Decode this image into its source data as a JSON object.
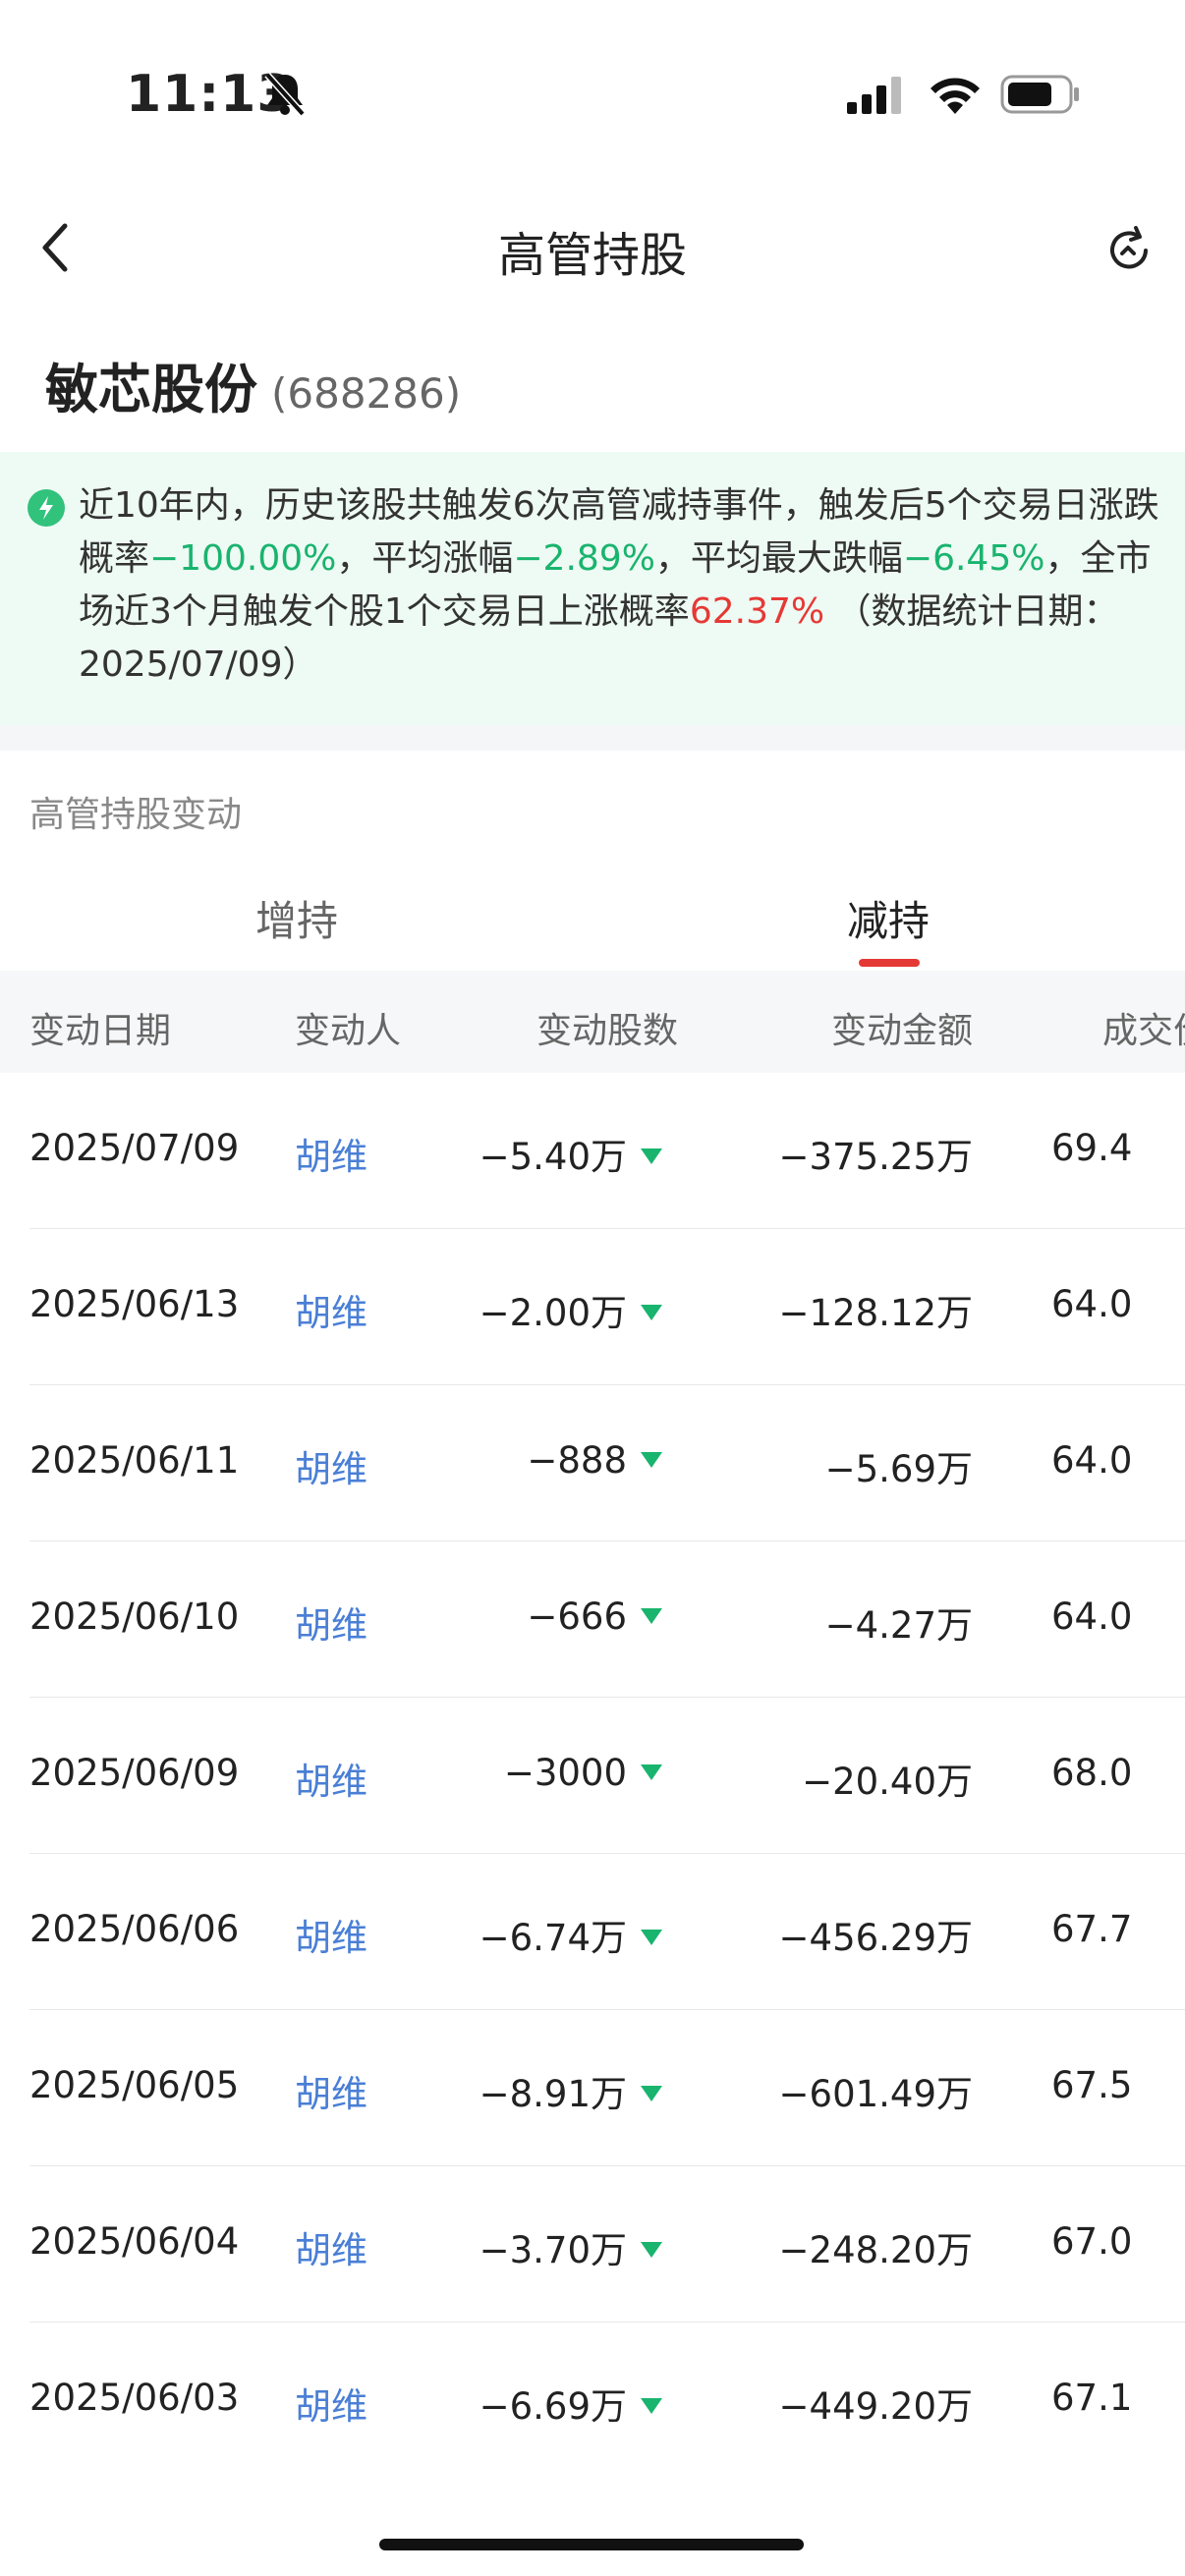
{
  "status_bar": {
    "time": "11:13"
  },
  "nav": {
    "title": "高管持股"
  },
  "stock": {
    "name": "敏芯股份",
    "code": "(688286)"
  },
  "alert": {
    "text_1": "近10年内，历史该股共触发6次高管减持事件，触发后5个交易日涨跌概率",
    "rise_prob": "−100.00%",
    "text_2": "，平均涨幅",
    "avg_rise": "−2.89%",
    "text_3": "，平均最大跌幅",
    "avg_max_drop": "−6.45%",
    "text_4": "，全市场近3个月触发个股1个交易日上涨概率",
    "market_prob": "62.37%",
    "text_5": " （数据统计日期：2025/07/09）"
  },
  "section": {
    "title": "高管持股变动"
  },
  "tabs": [
    {
      "label": "增持"
    },
    {
      "label": "减持"
    }
  ],
  "table": {
    "headers": {
      "date": "变动日期",
      "person": "变动人",
      "shares": "变动股数",
      "amount": "变动金额",
      "price": "成交价"
    },
    "rows": [
      {
        "date": "2025/07/09",
        "person": "胡维",
        "shares": "−5.40万",
        "amount": "−375.25万",
        "price": "69.4"
      },
      {
        "date": "2025/06/13",
        "person": "胡维",
        "shares": "−2.00万",
        "amount": "−128.12万",
        "price": "64.0"
      },
      {
        "date": "2025/06/11",
        "person": "胡维",
        "shares": "−888",
        "amount": "−5.69万",
        "price": "64.0"
      },
      {
        "date": "2025/06/10",
        "person": "胡维",
        "shares": "−666",
        "amount": "−4.27万",
        "price": "64.0"
      },
      {
        "date": "2025/06/09",
        "person": "胡维",
        "shares": "−3000",
        "amount": "−20.40万",
        "price": "68.0"
      },
      {
        "date": "2025/06/06",
        "person": "胡维",
        "shares": "−6.74万",
        "amount": "−456.29万",
        "price": "67.7"
      },
      {
        "date": "2025/06/05",
        "person": "胡维",
        "shares": "−8.91万",
        "amount": "−601.49万",
        "price": "67.5"
      },
      {
        "date": "2025/06/04",
        "person": "胡维",
        "shares": "−3.70万",
        "amount": "−248.20万",
        "price": "67.0"
      },
      {
        "date": "2025/06/03",
        "person": "胡维",
        "shares": "−6.69万",
        "amount": "−449.20万",
        "price": "67.1"
      }
    ]
  },
  "colors": {
    "green": "#19b46e",
    "red": "#e53935",
    "link": "#4a7fd6"
  }
}
